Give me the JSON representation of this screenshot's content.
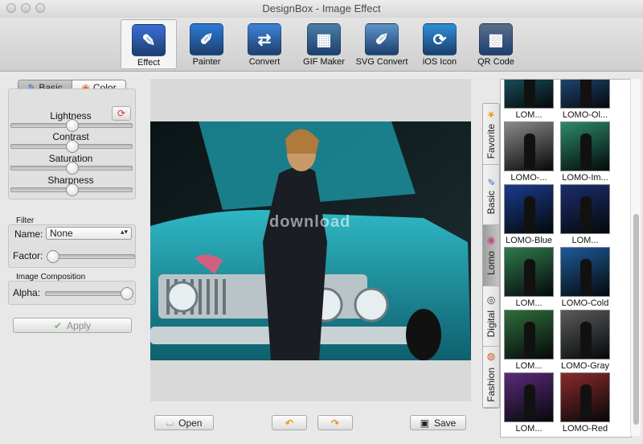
{
  "window": {
    "title": "DesignBox - Image Effect"
  },
  "toolbar": {
    "items": [
      {
        "label": "Effect",
        "icon": "effect-icon",
        "active": true,
        "color": "#3a6fd8"
      },
      {
        "label": "Painter",
        "icon": "painter-icon",
        "active": false,
        "color": "#2c7bd6"
      },
      {
        "label": "Convert",
        "icon": "convert-icon",
        "active": false,
        "color": "#3f84d8"
      },
      {
        "label": "GIF Maker",
        "icon": "gif-maker-icon",
        "active": false,
        "color": "#4a7fa8"
      },
      {
        "label": "SVG Convert",
        "icon": "svg-convert-icon",
        "active": false,
        "color": "#5d95c8"
      },
      {
        "label": "iOS Icon",
        "icon": "ios-icon-icon",
        "active": false,
        "color": "#2f8fd6"
      },
      {
        "label": "QR Code",
        "icon": "qr-code-icon",
        "active": false,
        "color": "#5b6f8a"
      }
    ]
  },
  "left": {
    "seg_basic": "Basic",
    "seg_color": "Color",
    "adjust": [
      {
        "label": "Lightness",
        "value": 0.5
      },
      {
        "label": "Contrast",
        "value": 0.5
      },
      {
        "label": "Saturation",
        "value": 0.5
      },
      {
        "label": "Sharpness",
        "value": 0.5
      }
    ],
    "filter_title": "Filter",
    "name_label": "Name:",
    "name_value": "None",
    "factor_label": "Factor:",
    "factor_value": 0.0,
    "composition_title": "Image Composition",
    "alpha_label": "Alpha:",
    "alpha_value": 1.0,
    "apply_label": "Apply"
  },
  "canvas": {
    "watermark": "download"
  },
  "bottom": {
    "open_label": "Open",
    "save_label": "Save"
  },
  "tabs": [
    {
      "label": "Favorite",
      "icon": "star-icon",
      "active": false
    },
    {
      "label": "Basic",
      "icon": "brush-icon",
      "active": false
    },
    {
      "label": "Lomo",
      "icon": "circle-icon",
      "active": true
    },
    {
      "label": "Digital",
      "icon": "camera-icon",
      "active": false
    },
    {
      "label": "Fashion",
      "icon": "palette-icon",
      "active": false
    }
  ],
  "gallery": [
    {
      "caption": "LOM...",
      "tint": "#1e6b7a"
    },
    {
      "caption": "LOMO-Ol...",
      "tint": "#2a5fa0"
    },
    {
      "caption": "LOMO-...",
      "tint": "#8a8a8a"
    },
    {
      "caption": "LOMO-Im...",
      "tint": "#2b8a6a"
    },
    {
      "caption": "LOMO-Blue",
      "tint": "#1a3c8c"
    },
    {
      "caption": "LOM...",
      "tint": "#1c2e6e"
    },
    {
      "caption": "LOM...",
      "tint": "#2f7a4e"
    },
    {
      "caption": "LOMO-Cold",
      "tint": "#1e5a9a"
    },
    {
      "caption": "LOM...",
      "tint": "#2e6e3a"
    },
    {
      "caption": "LOMO-Gray",
      "tint": "#5a5a5a"
    },
    {
      "caption": "LOM...",
      "tint": "#5a2a7a"
    },
    {
      "caption": "LOMO-Red",
      "tint": "#8a2a2a"
    }
  ]
}
